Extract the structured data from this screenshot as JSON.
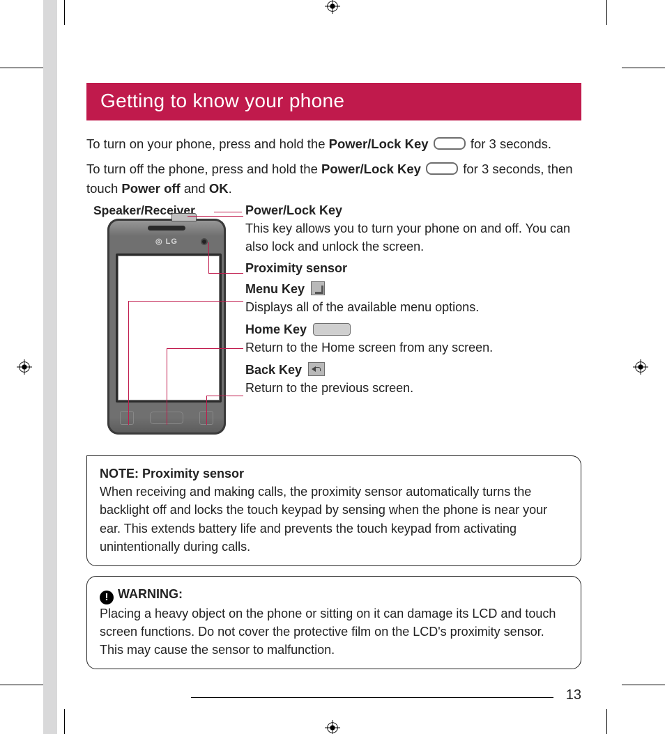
{
  "title": "Getting to know your phone",
  "intro": {
    "on": {
      "pre": "To turn on your phone, press and hold the ",
      "keyLabel": "Power/Lock Key",
      "post": " for 3 seconds."
    },
    "off": {
      "pre": "To turn off the phone, press and hold the ",
      "keyLabel": "Power/Lock Key",
      "post": " for 3 seconds, then touch ",
      "bold1": "Power off",
      "and": " and ",
      "bold2": "OK"
    }
  },
  "diagram": {
    "speakerLabel": "Speaker/Receiver",
    "logo": "◎ LG"
  },
  "callouts": {
    "power": {
      "title": "Power/Lock Key",
      "desc": "This key allows you to turn your phone on and off. You can also lock and unlock the screen."
    },
    "prox": {
      "title": "Proximity sensor"
    },
    "menu": {
      "title": "Menu Key",
      "desc": "Displays all of the available menu options."
    },
    "home": {
      "title": "Home Key",
      "desc": "Return to the Home screen from any screen."
    },
    "back": {
      "title": "Back Key",
      "desc": "Return to the previous screen."
    }
  },
  "note": {
    "title": "NOTE: Proximity sensor",
    "body": "When receiving and making calls, the proximity sensor automatically turns the backlight off and locks the touch keypad by sensing when the phone is near your ear. This extends battery life and prevents the touch keypad from activating unintentionally during calls."
  },
  "warning": {
    "title": "WARNING:",
    "body": "Placing a heavy object on the phone or sitting on it can damage its LCD and touch screen functions. Do not cover the protective film on the LCD's proximity sensor. This may cause the sensor to malfunction."
  },
  "pageNumber": "13"
}
